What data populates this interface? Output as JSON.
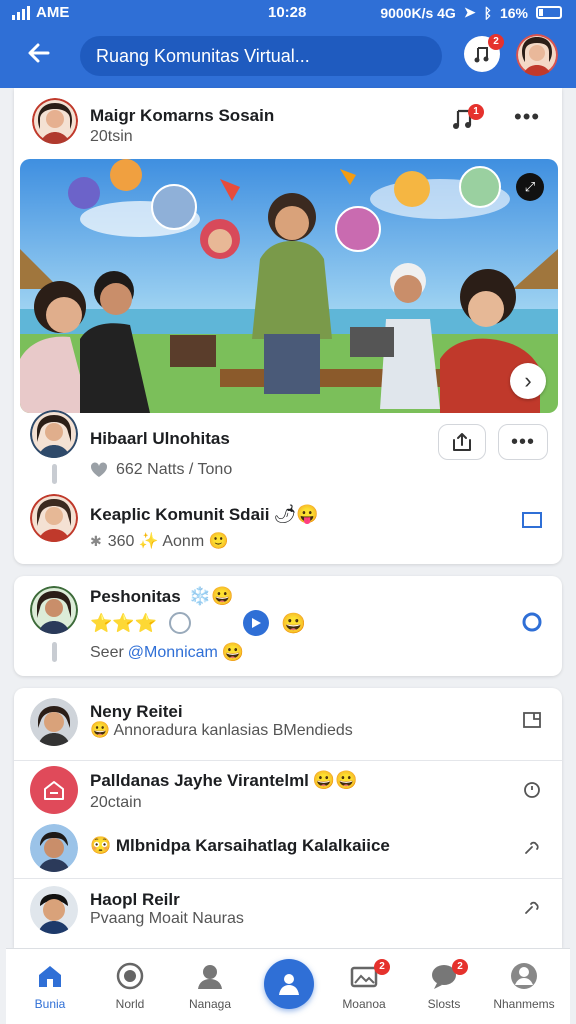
{
  "status_bar": {
    "carrier": "AME",
    "time": "10:28",
    "network": "9000K/s 4G",
    "battery": "16%"
  },
  "header": {
    "back_icon": "arrow-left-icon",
    "title": "Ruang Komunitas Virtual...",
    "notification_icon": "music-note-icon",
    "notification_badge": "2"
  },
  "post": {
    "author": "Maigr Komarns Sosain",
    "timestamp": "20tsin",
    "badge": "1",
    "image_alt": "Group of friends waving and laughing by the beach with floating profile bubbles"
  },
  "post_comments": [
    {
      "name": "Hibaarl Ulnohitas",
      "meta": "662 Natts / Tono"
    },
    {
      "name": "Keaplic Komunit Sdaii",
      "emoji": "🌶😛",
      "meta": "360 ✨ Aonm 🙂"
    }
  ],
  "activity": {
    "name": "Peshonitas",
    "name_emoji": "❄️😀",
    "reactions": "⭐⭐⭐",
    "smile_emoji": "😀",
    "sub_prefix": "Seer",
    "sub_link": "@Monnicam",
    "sub_emoji": "😀"
  },
  "list_items": [
    {
      "name": "Neny Reitei",
      "sub": "😀 Annoradura kanlasias BMendieds"
    },
    {
      "name": "Palldanas Jayhe Virantelml",
      "emoji": "😀😀",
      "sub": "20ctain"
    },
    {
      "name": "😳 Mlbnidpa Karsaihatlag Kalalkaiice",
      "sub": ""
    },
    {
      "name": "Haopl Reilr",
      "sub": "Pvaang Moait Nauras"
    }
  ],
  "bottom_nav": [
    {
      "label": "Bunia",
      "icon": "home-icon",
      "active": true
    },
    {
      "label": "Norld",
      "icon": "globe-icon",
      "active": false
    },
    {
      "label": "Nanaga",
      "icon": "people-icon",
      "active": false
    },
    {
      "label": "",
      "icon": "create-post-icon",
      "active": false
    },
    {
      "label": "Moanoa",
      "icon": "media-icon",
      "active": false,
      "badge": "2"
    },
    {
      "label": "Slosts",
      "icon": "chat-icon",
      "active": false,
      "badge": "2"
    },
    {
      "label": "Nhanmems",
      "icon": "profile-icon",
      "active": false
    }
  ],
  "colors": {
    "brand": "#2f6fd6",
    "badge": "#e5322d"
  }
}
